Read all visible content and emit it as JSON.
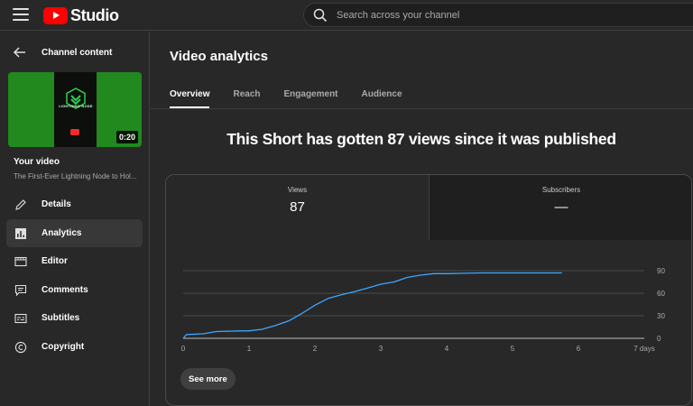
{
  "header": {
    "logo_text": "Studio",
    "search_placeholder": "Search across your channel"
  },
  "sidebar": {
    "back_label": "Channel content",
    "thumbnail": {
      "duration": "0:20",
      "poster_text": "LIGHTNING NODE"
    },
    "your_video_label": "Your video",
    "video_title": "The First-Ever Lightning Node to Hol...",
    "nav": [
      {
        "label": "Details",
        "icon": "pencil-icon",
        "active": false
      },
      {
        "label": "Analytics",
        "icon": "analytics-icon",
        "active": true
      },
      {
        "label": "Editor",
        "icon": "film-icon",
        "active": false
      },
      {
        "label": "Comments",
        "icon": "comment-icon",
        "active": false
      },
      {
        "label": "Subtitles",
        "icon": "subtitles-icon",
        "active": false
      },
      {
        "label": "Copyright",
        "icon": "copyright-icon",
        "active": false
      }
    ]
  },
  "main": {
    "title": "Video analytics",
    "tabs": [
      "Overview",
      "Reach",
      "Engagement",
      "Audience"
    ],
    "active_tab": "Overview",
    "headline": "This Short has gotten 87 views since it was published",
    "metrics": [
      {
        "name": "Views",
        "value": "87"
      },
      {
        "name": "Subscribers",
        "value": "—"
      }
    ],
    "see_more_label": "See more"
  },
  "chart_data": {
    "type": "line",
    "series": [
      {
        "color": "#3ea6ff",
        "x": [
          0,
          0.05,
          0.3,
          0.5,
          0.9,
          1.0,
          1.2,
          1.4,
          1.6,
          1.8,
          2.0,
          2.2,
          2.4,
          2.6,
          2.8,
          3.0,
          3.2,
          3.4,
          3.6,
          3.8,
          4.0,
          4.5,
          5.0,
          5.5,
          5.75
        ],
        "y": [
          0,
          5,
          6,
          9,
          10,
          10,
          12,
          17,
          23,
          33,
          44,
          53,
          58,
          62,
          67,
          72,
          75,
          81,
          84,
          86,
          86,
          87,
          87,
          87,
          87
        ]
      }
    ],
    "x_ticks": [
      "0",
      "1",
      "2",
      "3",
      "4",
      "5",
      "6",
      "7 days"
    ],
    "y_ticks": [
      "0",
      "30",
      "60",
      "90"
    ],
    "xlim": [
      0,
      7
    ],
    "ylim": [
      0,
      90
    ],
    "grid": true
  },
  "colors": {
    "accent_line": "#3ea6ff",
    "brand_red": "#ff0000",
    "background": "#282828"
  }
}
